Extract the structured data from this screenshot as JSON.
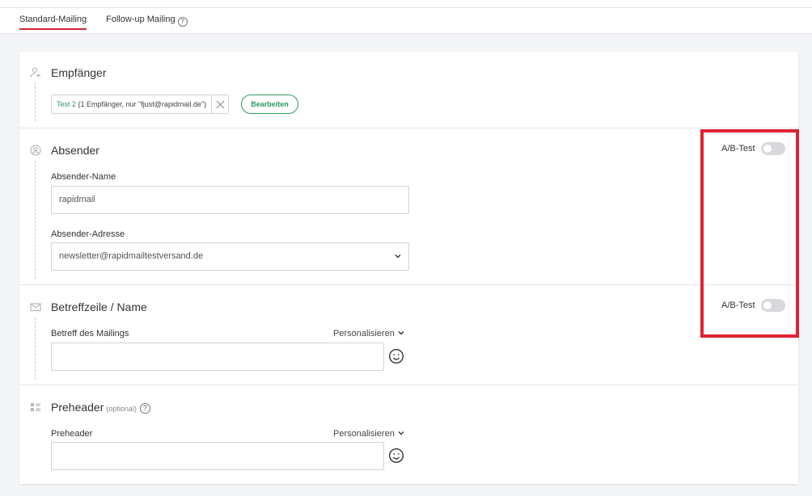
{
  "tabs": [
    {
      "label": "Standard-Mailing",
      "active": true
    },
    {
      "label": "Follow-up Mailing",
      "help": "?"
    }
  ],
  "recipients": {
    "title": "Empfänger",
    "chip_list": "Test 2",
    "chip_detail": " (1 Empfänger, nur \"fjust@rapidmail.de\")",
    "edit_button": "Bearbeiten"
  },
  "sender": {
    "title": "Absender",
    "ab_label": "A/B-Test",
    "ab_enabled": false,
    "name_label": "Absender-Name",
    "name_value": "rapidmail",
    "address_label": "Absender-Adresse",
    "address_value": "newsletter@rapidmailtestversand.de"
  },
  "subject": {
    "title": "Betreffzeile / Name",
    "ab_label": "A/B-Test",
    "ab_enabled": false,
    "field_label": "Betreff des Mailings",
    "personalize": "Personalisieren",
    "value": ""
  },
  "preheader": {
    "title": "Preheader",
    "optional": "(optional)",
    "help": "?",
    "field_label": "Preheader",
    "personalize": "Personalisieren",
    "value": ""
  },
  "colors": {
    "accent_red": "#d0283a",
    "green": "#2f9a5e",
    "highlight": "#e02232"
  }
}
